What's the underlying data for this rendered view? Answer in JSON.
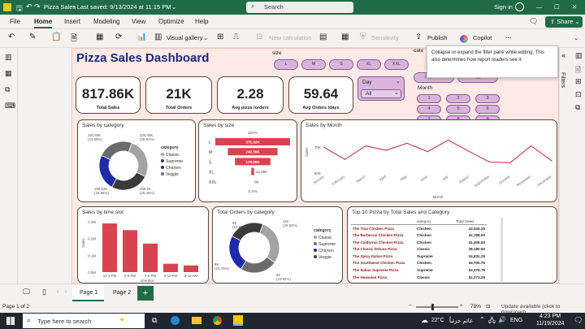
{
  "titlebar": {
    "app_title": "Pizza Sales",
    "saved": "• Last saved: 9/13/2024 at 11:15 PM",
    "search_placeholder": "Search",
    "signin": "Sign in"
  },
  "menu": [
    "File",
    "Home",
    "Insert",
    "Modeling",
    "View",
    "Optimize",
    "Help"
  ],
  "share_label": "Share",
  "ribbon": {
    "visual_gallery": "Visual gallery",
    "new_calculation": "New calculation",
    "sensitivity": "Sensitivity",
    "publish": "Publish",
    "copilot": "Copilot"
  },
  "tooltip": "Collapse or expand the filter pane while editing. This also determines how report readers see it",
  "filters_label": "Filters",
  "dashboard": {
    "title": "Pizza Sales Dashboard",
    "kpis": [
      {
        "value": "817.86K",
        "label": "Total Sales"
      },
      {
        "value": "21K",
        "label": "Total Orders"
      },
      {
        "value": "2.28",
        "label": "Avg pizza /orders"
      },
      {
        "value": "59.64",
        "label": "Avg Orders /days"
      }
    ],
    "size_slicer": {
      "title": "size",
      "options": [
        "L",
        "M",
        "S",
        "XL",
        "XXL"
      ]
    },
    "category_slicer": {
      "title": "cate",
      "options": [
        "Supreme",
        "Veggie"
      ]
    },
    "day_slicer": {
      "title": "Day",
      "value": "All"
    },
    "month_slicer": {
      "title": "Month",
      "options": [
        "1",
        "2",
        "3",
        "4",
        "5",
        "6",
        "7",
        "8",
        "9"
      ]
    }
  },
  "chart_data": [
    {
      "type": "pie",
      "title": "Sales by category",
      "legend_title": "category",
      "labels": [
        "Classic",
        "Supreme",
        "Chicken",
        "Veggie"
      ],
      "values": [
        220.05,
        208.2,
        195.92,
        193.69
      ],
      "value_labels": [
        "220.05K (26.91%)",
        "208.2K (25.46%)",
        "195.92K (23.96%)",
        "193.69K (23.68%)"
      ],
      "colors": [
        "#a3a3a3",
        "#3a3a3a",
        "#1f2aa8",
        "#6b6b6b"
      ]
    },
    {
      "type": "bar",
      "title": "Sales by size",
      "categories": [
        "L",
        "M",
        "S",
        "XL",
        "XXL"
      ],
      "values": [
        375.32,
        249.38,
        178.08,
        14.08,
        0.0
      ],
      "value_labels": [
        "375.32K",
        "249.38K",
        "178.08K",
        "14.08K",
        "0K"
      ],
      "top_label": "100%",
      "bottom_label": "0.0%",
      "color": "#d9434f"
    },
    {
      "type": "line",
      "title": "Sales by Month",
      "xlabel": "Month",
      "ylabel": "Sales",
      "categories": [
        "January",
        "February",
        "March",
        "April",
        "May",
        "June",
        "July",
        "August",
        "September",
        "October",
        "November",
        "December"
      ],
      "values": [
        69.8,
        65.2,
        70.4,
        68.7,
        71.4,
        68.2,
        72.6,
        68.3,
        64.2,
        64.0,
        70.4,
        64.7
      ],
      "yticks": [
        "60K",
        "70K"
      ],
      "ylim": [
        60,
        74
      ],
      "color": "#b83a4b"
    },
    {
      "type": "bar",
      "title": "Sales by time slot",
      "xlabel": "time slot",
      "ylabel": "Sales",
      "categories": [
        "12-3 PM",
        "6-9 PM",
        "3-6 PM",
        "9-12 PM",
        "9-12 AM"
      ],
      "values": [
        0.29,
        0.25,
        0.17,
        0.05,
        0.04
      ],
      "yticks": [
        "0.0M",
        "0.1M",
        "0.2M",
        "0.3M"
      ],
      "ylim": [
        0,
        0.3
      ],
      "color": "#d9434f"
    },
    {
      "type": "pie",
      "title": "Total Orders by category",
      "legend_title": "category",
      "labels": [
        "Classic",
        "Supreme",
        "Chicken",
        "Veggie"
      ],
      "values": [
        29.52,
        23.92,
        23.7,
        22.86
      ],
      "value_labels": [
        "11K (29.52%)",
        "8K (23.92%)",
        "8K (23.70%)",
        "8K (22.86%)"
      ],
      "colors": [
        "#a3a3a3",
        "#6b6b6b",
        "#1f2aa8",
        "#3a3a3a"
      ]
    },
    {
      "type": "table",
      "title": "Top 10 Pizza by Total Sales and Category",
      "columns": [
        "pizza_name",
        "category",
        "Total Sales"
      ],
      "rows": [
        [
          "The Thai Chicken Pizza",
          "Chicken",
          "43,434.25"
        ],
        [
          "The Barbecue Chicken Pizza",
          "Chicken",
          "42,768.00"
        ],
        [
          "The California Chicken Pizza",
          "Chicken",
          "41,409.50"
        ],
        [
          "The Classic Deluxe Pizza",
          "Classic",
          "38,180.50"
        ],
        [
          "The Spicy Italian Pizza",
          "Supreme",
          "34,831.25"
        ],
        [
          "The Southwest Chicken Pizza",
          "Chicken",
          "34,705.75"
        ],
        [
          "The Italian Supreme Pizza",
          "Supreme",
          "33,476.75"
        ],
        [
          "The Hawaiian Pizza",
          "Classic",
          "32,273.25"
        ]
      ]
    }
  ],
  "pages": [
    "Page 1",
    "Page 2"
  ],
  "status": {
    "page": "Page 1 of 2",
    "zoom": "78%",
    "update": "Update available (click to download)"
  },
  "taskbar": {
    "search": "Type here to search",
    "weather": "22°C",
    "weather_ar": "غائم جزئياً",
    "lang": "ENG",
    "time": "4:23 PM",
    "date": "11/19/2024"
  }
}
